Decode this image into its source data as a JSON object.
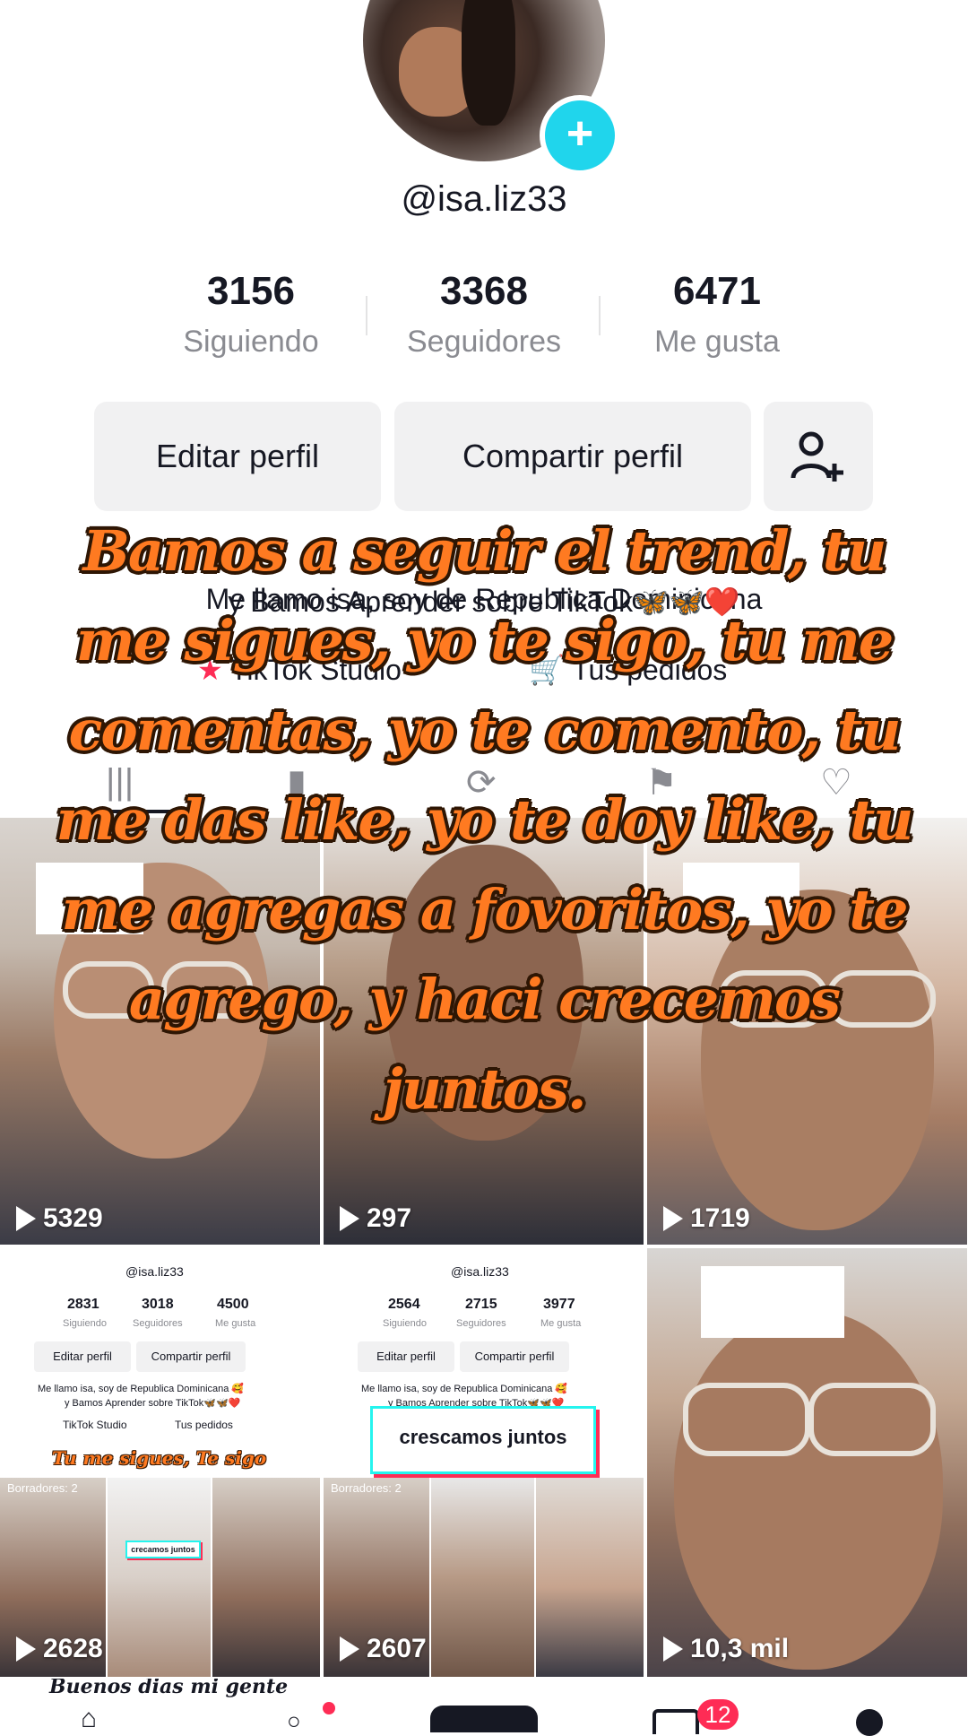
{
  "profile": {
    "username": "@isa.liz33",
    "stats": [
      {
        "value": "3156",
        "label": "Siguiendo"
      },
      {
        "value": "3368",
        "label": "Seguidores"
      },
      {
        "value": "6471",
        "label": "Me gusta"
      }
    ],
    "edit_label": "Editar perfil",
    "share_label": "Compartir perfil",
    "bio_line1": "Me llamo isa, soy de Republica Dominicana",
    "bio_line2": "y Bamos Aprender sobre TikTok🦋🦋❤️",
    "links": [
      "TikTok Studio",
      "Tus pedidos"
    ]
  },
  "caption": "Bamos a seguir el trend, tu me sigues, yo te sigo, tu me comentas, yo te comento, tu me das like, yo te doy like, tu me agregas a fovoritos, yo te agrego, y haci crecemos juntos.",
  "videos": [
    {
      "views": "5329"
    },
    {
      "views": "297"
    },
    {
      "views": "1719"
    },
    {
      "views": "2628"
    },
    {
      "views": "2607"
    },
    {
      "views": "10,3 mil"
    }
  ],
  "mini_profile_1": {
    "username": "@isa.liz33",
    "stats": [
      {
        "value": "2831",
        "label": "Siguiendo"
      },
      {
        "value": "3018",
        "label": "Seguidores"
      },
      {
        "value": "4500",
        "label": "Me gusta"
      }
    ],
    "edit_label": "Editar perfil",
    "share_label": "Compartir perfil",
    "bio_line1": "Me llamo isa, soy de Republica Dominicana 🥰",
    "bio_line2": "y Bamos Aprender sobre TikTok🦋🦋❤️",
    "studio": "TikTok Studio",
    "orders": "Tus pedidos",
    "overlay": "Tu me sigues, Te sigo",
    "drafts": "Borradores: 2",
    "sticker": "crecamos juntos"
  },
  "mini_profile_2": {
    "username": "@isa.liz33",
    "stats": [
      {
        "value": "2564",
        "label": "Siguiendo"
      },
      {
        "value": "2715",
        "label": "Seguidores"
      },
      {
        "value": "3977",
        "label": "Me gusta"
      }
    ],
    "edit_label": "Editar perfil",
    "share_label": "Compartir perfil",
    "bio_line1": "Me llamo isa, soy de Republica Dominicana 🥰",
    "bio_line2": "y Bamos Aprender sobre TikTok🦋🦋❤️",
    "drafts": "Borradores: 2",
    "sticker": "crescamos juntos"
  },
  "bottom_text": "Buenos dias mi gente",
  "nav": {
    "inbox_badge": "12"
  },
  "colors": {
    "accent_cyan": "#20d5ec",
    "tiktok_red": "#fe2c55",
    "caption_orange": "#ff7a21"
  }
}
